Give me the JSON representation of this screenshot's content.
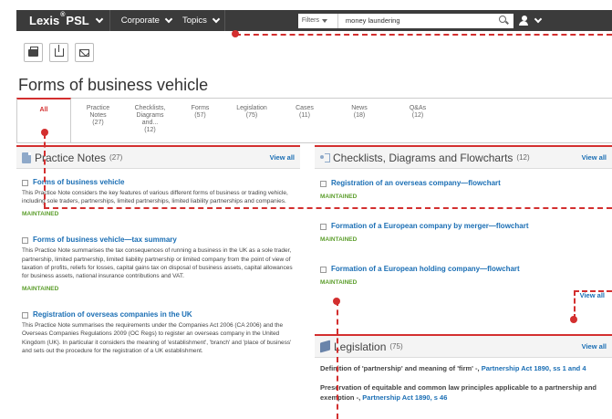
{
  "topbar": {
    "brand": "Lexis",
    "brand_reg": "®",
    "brand_psl": "PSL",
    "nav": [
      "Corporate",
      "Topics"
    ],
    "filters_label": "Filters",
    "search_value": "money laundering"
  },
  "toolbar": {
    "print": "print-icon",
    "download": "download-icon",
    "email": "email-icon"
  },
  "page_title": "Forms of business vehicle",
  "tabs": [
    {
      "label": "All",
      "count": ""
    },
    {
      "label": "Practice Notes",
      "count": "(27)"
    },
    {
      "label": "Checklists, Diagrams and...",
      "count": "(12)"
    },
    {
      "label": "Forms",
      "count": "(57)"
    },
    {
      "label": "Legislation",
      "count": "(75)"
    },
    {
      "label": "Cases",
      "count": "(11)"
    },
    {
      "label": "News",
      "count": "(18)"
    },
    {
      "label": "Q&As",
      "count": "(12)"
    }
  ],
  "practice_notes": {
    "title": "Practice Notes",
    "count": "(27)",
    "view_all": "View all",
    "items": [
      {
        "title": "Forms of business vehicle",
        "desc": "This Practice Note considers the key features of various different forms of business or trading vehicle, including sole traders, partnerships, limited partnerships, limited liability partnerships and companies.",
        "status": "MAINTAINED"
      },
      {
        "title": "Forms of business vehicle—tax summary",
        "desc": "This Practice Note summarises the tax consequences of running a business in the UK as a sole trader, partnership, limited partnership, limited liability partnership or limited company from the point of view of taxation of profits, reliefs for losses, capital gains tax on disposal of business assets, capital allowances for business assets, national insurance contributions and VAT.",
        "status": "MAINTAINED"
      },
      {
        "title": "Registration of overseas companies in the UK",
        "desc": "This Practice Note summarises the requirements under the Companies Act 2006 (CA 2006) and the Overseas Companies Regulations 2009 (OC Regs) to register an overseas company in the United Kingdom (UK). In particular it considers the meaning of 'establishment', 'branch' and 'place of business' and sets out the procedure for the registration of a UK establishment."
      }
    ]
  },
  "checklists": {
    "title": "Checklists, Diagrams and Flowcharts",
    "count": "(12)",
    "view_all": "View all",
    "items": [
      {
        "title": "Registration of an overseas company—flowchart",
        "status": "MAINTAINED"
      },
      {
        "title": "Formation of a European company by merger—flowchart",
        "status": "MAINTAINED"
      },
      {
        "title": "Formation of a European holding company—flowchart",
        "status": "MAINTAINED"
      }
    ],
    "view_all_bottom": "View all"
  },
  "legislation": {
    "title": "Legislation",
    "count": "(75)",
    "view_all": "View all",
    "items": [
      {
        "text": "Definition of 'partnership' and meaning of 'firm' -, ",
        "link": "Partnership Act 1890, ss 1 and 4"
      },
      {
        "text": "Preservation of equitable and common law principles applicable to a partnership and exemption -, ",
        "link": "Partnership Act 1890, s 46"
      }
    ]
  },
  "colors": {
    "accent": "#d32f2f",
    "link": "#1a6eb4",
    "maintained": "#5c9e2c",
    "topbar": "#3b3b3b"
  }
}
